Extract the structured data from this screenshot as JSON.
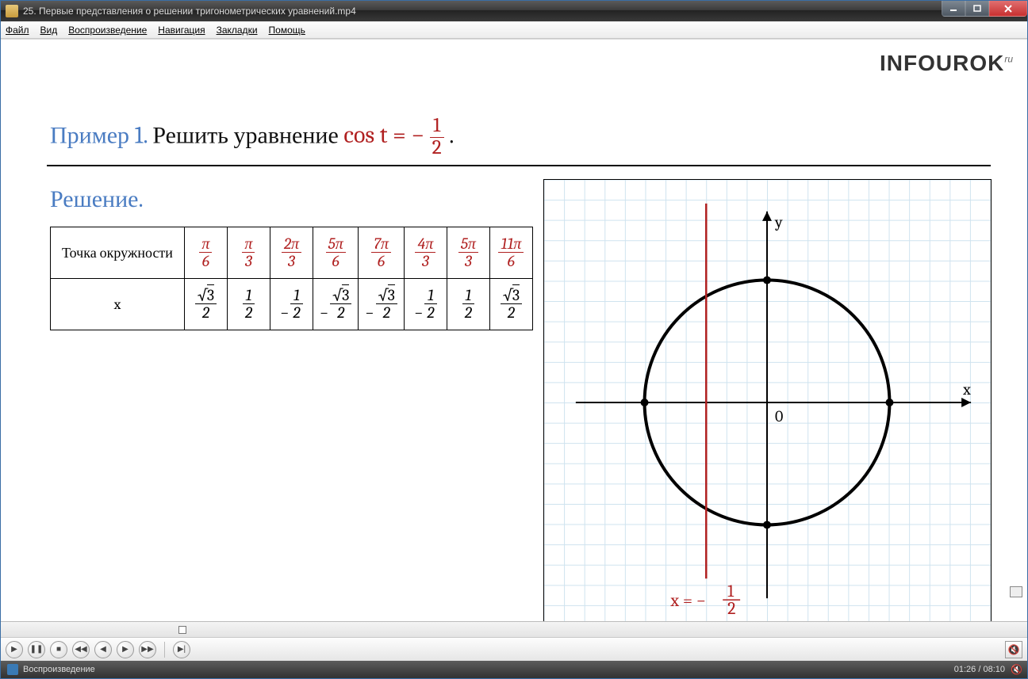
{
  "window": {
    "title": "25. Первые представления о решении тригонометрических уравнений.mp4"
  },
  "menu": {
    "file": "Файл",
    "view": "Вид",
    "play": "Воспроизведение",
    "nav": "Навигация",
    "bookmarks": "Закладки",
    "help": "Помощь"
  },
  "brand": {
    "name": "INFOUROK",
    "tld": "ru"
  },
  "head": {
    "example": "Пример 1.",
    "text": " Решить уравнение ",
    "eq_lhs": "cos t = − ",
    "eq_num": "1",
    "eq_den": "2",
    "dot": " ."
  },
  "solution_label": "Решение.",
  "table": {
    "row1_head": "Точка окружности",
    "row2_head": "x",
    "row1": [
      {
        "n": "π",
        "d": "6"
      },
      {
        "n": "π",
        "d": "3"
      },
      {
        "n": "2π",
        "d": "3"
      },
      {
        "n": "5π",
        "d": "6"
      },
      {
        "n": "7π",
        "d": "6"
      },
      {
        "n": "4π",
        "d": "3"
      },
      {
        "n": "5π",
        "d": "3"
      },
      {
        "n": "11π",
        "d": "6"
      }
    ],
    "row2": [
      {
        "neg": false,
        "sqrt": true,
        "n": "3",
        "d": "2"
      },
      {
        "neg": false,
        "sqrt": false,
        "n": "1",
        "d": "2"
      },
      {
        "neg": true,
        "sqrt": false,
        "n": "1",
        "d": "2"
      },
      {
        "neg": true,
        "sqrt": true,
        "n": "3",
        "d": "2"
      },
      {
        "neg": true,
        "sqrt": true,
        "n": "3",
        "d": "2"
      },
      {
        "neg": true,
        "sqrt": false,
        "n": "1",
        "d": "2"
      },
      {
        "neg": false,
        "sqrt": false,
        "n": "1",
        "d": "2"
      },
      {
        "neg": false,
        "sqrt": true,
        "n": "3",
        "d": "2"
      }
    ]
  },
  "graph": {
    "x_label": "x",
    "y_label": "y",
    "origin": "0",
    "line_label_prefix": "x = − ",
    "line_num": "1",
    "line_den": "2",
    "vertical_line_x": -0.5
  },
  "status": {
    "text": "Воспроизведение",
    "time": "01:26 / 08:10"
  },
  "chart_data": {
    "type": "line",
    "title": "Unit circle with vertical line x = −1/2",
    "xlabel": "x",
    "ylabel": "y",
    "xlim": [
      -1.4,
      1.4
    ],
    "ylim": [
      -1.4,
      1.4
    ],
    "series": [
      {
        "name": "unit-circle",
        "equation": "x^2 + y^2 = 1"
      },
      {
        "name": "vertical-line",
        "x": [
          -0.5,
          -0.5
        ],
        "y": [
          -1.4,
          1.4
        ]
      }
    ],
    "points": [
      {
        "x": 1,
        "y": 0
      },
      {
        "x": -1,
        "y": 0
      },
      {
        "x": 0,
        "y": 1
      },
      {
        "x": 0,
        "y": -1
      }
    ]
  }
}
